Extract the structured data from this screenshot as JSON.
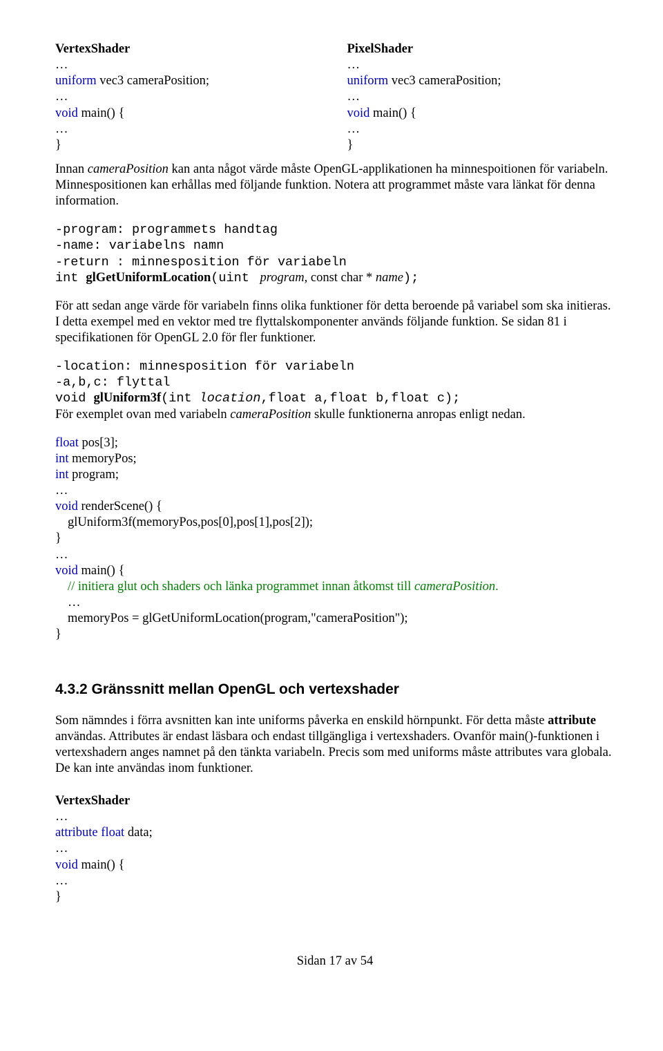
{
  "shaders": {
    "vs_title": "VertexShader",
    "ps_title": "PixelShader",
    "dots": "…",
    "uniform_kw": "uniform",
    "vec3": " vec3 ",
    "camPos": "cameraPosition;",
    "void_kw": "void",
    "main_sig": " main() {",
    "close": "}"
  },
  "p1_a": "Innan ",
  "p1_b": "cameraPosition",
  "p1_c": " kan anta något värde måste OpenGL-applikationen ha minnespoitionen för variabeln. Minnespositionen kan erhållas med följande funktion. Notera att programmet måste vara länkat för denna information.",
  "sig1": {
    "l1": "-program: programmets handtag",
    "l2": "-name: variabelns namn",
    "l3": "-return : minnesposition för variabeln",
    "ret": "int ",
    "fn": "glGetUniformLocation",
    "open": "(",
    "a1t": "uint ",
    "a1n": " program, ",
    "a2t": "const char * ",
    "a2n": "name",
    "close": ");"
  },
  "p2": "För att sedan ange värde för variabeln finns olika funktioner för detta beroende på variabel som ska initieras. I detta exempel med en vektor med tre flyttalskomponenter används följande funktion. Se sidan 81 i specifikationen för OpenGL 2.0 för fler funktioner.",
  "sig2": {
    "l1": "-location: minnesposition för variabeln",
    "l2": "-a,b,c: flyttal",
    "ret": "void ",
    "fn": "glUniform3f",
    "open": "(",
    "int_kw": "int ",
    "loc": "location",
    "c1": ",",
    "flt": "float ",
    "a": "a",
    "b": "b",
    "c": "c",
    "close": ");"
  },
  "p3_a": "För exemplet ovan med variabeln ",
  "p3_b": "cameraPosition",
  "p3_c": " skulle funktionerna anropas enligt nedan.",
  "host": {
    "float_kw": "float",
    "pos": " pos[3];",
    "int_kw": "int",
    "memPos": " memoryPos;",
    "prog": " program;",
    "dots": "…",
    "void_kw": "void",
    "render_sig": " renderScene() {",
    "render_body": "glUniform3f(memoryPos,pos[0],pos[1],pos[2]);",
    "close": "}",
    "main_sig": " main() {",
    "comment_a": "// initiera glut och shaders och länka programmet innan åtkomst till ",
    "comment_b": "cameraPosition",
    "comment_c": ".",
    "memAssign": "memoryPos = glGetUniformLocation(program,\"cameraPosition\");"
  },
  "h_432": "4.3.2 Gränssnitt mellan OpenGL och vertexshader",
  "p4_a": "Som nämndes i förra avsnitten kan inte uniforms påverka en enskild hörnpunkt. För detta måste ",
  "p4_b": "attribute",
  "p4_c": " användas. Attributes är endast läsbara och endast tillgängliga i vertexshaders. Ovanför main()-funktionen i vertexshadern anges namnet på den tänkta variabeln. Precis som med uniforms måste attributes vara globala. De kan inte användas inom funktioner.",
  "vs2": {
    "title": "VertexShader",
    "dots": "…",
    "attr_kw": "attribute",
    "float_kw": " float ",
    "data": "data;",
    "void_kw": "void",
    "main_sig": " main() {",
    "close": "}"
  },
  "footer": "Sidan 17 av 54"
}
